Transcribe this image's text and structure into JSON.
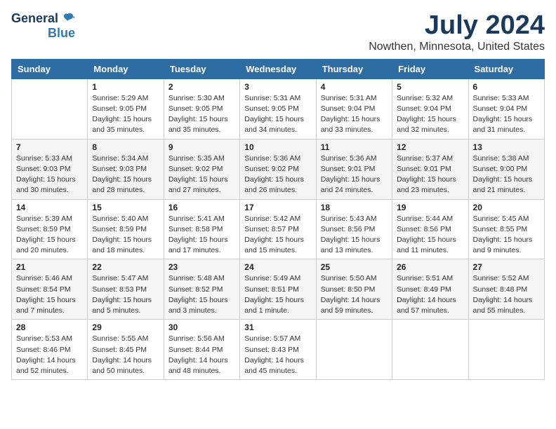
{
  "header": {
    "logo_general": "General",
    "logo_blue": "Blue",
    "title": "July 2024",
    "location": "Nowthen, Minnesota, United States"
  },
  "calendar": {
    "weekdays": [
      "Sunday",
      "Monday",
      "Tuesday",
      "Wednesday",
      "Thursday",
      "Friday",
      "Saturday"
    ],
    "weeks": [
      [
        {
          "day": "",
          "info": ""
        },
        {
          "day": "1",
          "info": "Sunrise: 5:29 AM\nSunset: 9:05 PM\nDaylight: 15 hours\nand 35 minutes."
        },
        {
          "day": "2",
          "info": "Sunrise: 5:30 AM\nSunset: 9:05 PM\nDaylight: 15 hours\nand 35 minutes."
        },
        {
          "day": "3",
          "info": "Sunrise: 5:31 AM\nSunset: 9:05 PM\nDaylight: 15 hours\nand 34 minutes."
        },
        {
          "day": "4",
          "info": "Sunrise: 5:31 AM\nSunset: 9:04 PM\nDaylight: 15 hours\nand 33 minutes."
        },
        {
          "day": "5",
          "info": "Sunrise: 5:32 AM\nSunset: 9:04 PM\nDaylight: 15 hours\nand 32 minutes."
        },
        {
          "day": "6",
          "info": "Sunrise: 5:33 AM\nSunset: 9:04 PM\nDaylight: 15 hours\nand 31 minutes."
        }
      ],
      [
        {
          "day": "7",
          "info": "Sunrise: 5:33 AM\nSunset: 9:03 PM\nDaylight: 15 hours\nand 30 minutes."
        },
        {
          "day": "8",
          "info": "Sunrise: 5:34 AM\nSunset: 9:03 PM\nDaylight: 15 hours\nand 28 minutes."
        },
        {
          "day": "9",
          "info": "Sunrise: 5:35 AM\nSunset: 9:02 PM\nDaylight: 15 hours\nand 27 minutes."
        },
        {
          "day": "10",
          "info": "Sunrise: 5:36 AM\nSunset: 9:02 PM\nDaylight: 15 hours\nand 26 minutes."
        },
        {
          "day": "11",
          "info": "Sunrise: 5:36 AM\nSunset: 9:01 PM\nDaylight: 15 hours\nand 24 minutes."
        },
        {
          "day": "12",
          "info": "Sunrise: 5:37 AM\nSunset: 9:01 PM\nDaylight: 15 hours\nand 23 minutes."
        },
        {
          "day": "13",
          "info": "Sunrise: 5:38 AM\nSunset: 9:00 PM\nDaylight: 15 hours\nand 21 minutes."
        }
      ],
      [
        {
          "day": "14",
          "info": "Sunrise: 5:39 AM\nSunset: 8:59 PM\nDaylight: 15 hours\nand 20 minutes."
        },
        {
          "day": "15",
          "info": "Sunrise: 5:40 AM\nSunset: 8:59 PM\nDaylight: 15 hours\nand 18 minutes."
        },
        {
          "day": "16",
          "info": "Sunrise: 5:41 AM\nSunset: 8:58 PM\nDaylight: 15 hours\nand 17 minutes."
        },
        {
          "day": "17",
          "info": "Sunrise: 5:42 AM\nSunset: 8:57 PM\nDaylight: 15 hours\nand 15 minutes."
        },
        {
          "day": "18",
          "info": "Sunrise: 5:43 AM\nSunset: 8:56 PM\nDaylight: 15 hours\nand 13 minutes."
        },
        {
          "day": "19",
          "info": "Sunrise: 5:44 AM\nSunset: 8:56 PM\nDaylight: 15 hours\nand 11 minutes."
        },
        {
          "day": "20",
          "info": "Sunrise: 5:45 AM\nSunset: 8:55 PM\nDaylight: 15 hours\nand 9 minutes."
        }
      ],
      [
        {
          "day": "21",
          "info": "Sunrise: 5:46 AM\nSunset: 8:54 PM\nDaylight: 15 hours\nand 7 minutes."
        },
        {
          "day": "22",
          "info": "Sunrise: 5:47 AM\nSunset: 8:53 PM\nDaylight: 15 hours\nand 5 minutes."
        },
        {
          "day": "23",
          "info": "Sunrise: 5:48 AM\nSunset: 8:52 PM\nDaylight: 15 hours\nand 3 minutes."
        },
        {
          "day": "24",
          "info": "Sunrise: 5:49 AM\nSunset: 8:51 PM\nDaylight: 15 hours\nand 1 minute."
        },
        {
          "day": "25",
          "info": "Sunrise: 5:50 AM\nSunset: 8:50 PM\nDaylight: 14 hours\nand 59 minutes."
        },
        {
          "day": "26",
          "info": "Sunrise: 5:51 AM\nSunset: 8:49 PM\nDaylight: 14 hours\nand 57 minutes."
        },
        {
          "day": "27",
          "info": "Sunrise: 5:52 AM\nSunset: 8:48 PM\nDaylight: 14 hours\nand 55 minutes."
        }
      ],
      [
        {
          "day": "28",
          "info": "Sunrise: 5:53 AM\nSunset: 8:46 PM\nDaylight: 14 hours\nand 52 minutes."
        },
        {
          "day": "29",
          "info": "Sunrise: 5:55 AM\nSunset: 8:45 PM\nDaylight: 14 hours\nand 50 minutes."
        },
        {
          "day": "30",
          "info": "Sunrise: 5:56 AM\nSunset: 8:44 PM\nDaylight: 14 hours\nand 48 minutes."
        },
        {
          "day": "31",
          "info": "Sunrise: 5:57 AM\nSunset: 8:43 PM\nDaylight: 14 hours\nand 45 minutes."
        },
        {
          "day": "",
          "info": ""
        },
        {
          "day": "",
          "info": ""
        },
        {
          "day": "",
          "info": ""
        }
      ]
    ]
  }
}
